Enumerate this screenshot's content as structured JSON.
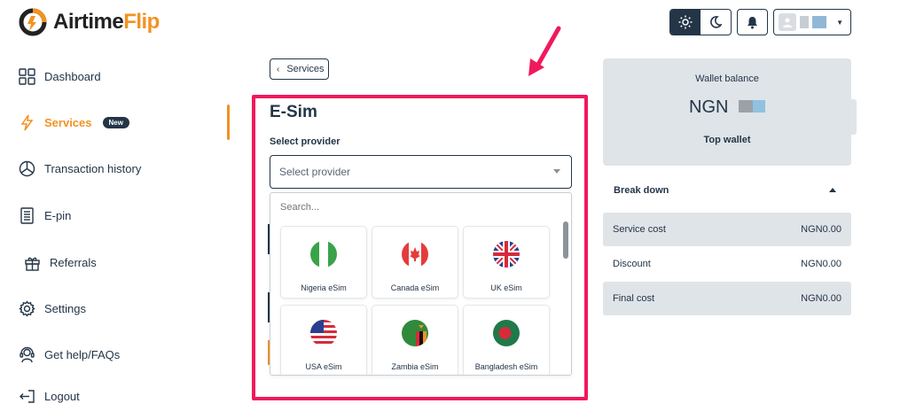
{
  "logo": {
    "text_a": "Airtime",
    "text_b": "Flip"
  },
  "sidebar": {
    "items": [
      {
        "label": "Dashboard",
        "icon": "grid-icon"
      },
      {
        "label": "Services",
        "icon": "lightning-icon",
        "badge": "New"
      },
      {
        "label": "Transaction history",
        "icon": "pie-chart-icon"
      },
      {
        "label": "E-pin",
        "icon": "receipt-icon"
      },
      {
        "label": "Referrals",
        "icon": "gift-icon"
      },
      {
        "label": "Settings",
        "icon": "gear-icon"
      },
      {
        "label": "Get help/FAQs",
        "icon": "headset-icon"
      },
      {
        "label": "Logout",
        "icon": "logout-icon"
      }
    ]
  },
  "header": {
    "theme": "light"
  },
  "back": {
    "label": "Services"
  },
  "esim": {
    "title": "E-Sim",
    "provider_label": "Select provider",
    "provider_placeholder": "Select provider",
    "search_placeholder": "Search...",
    "providers": [
      {
        "name": "Nigeria eSim",
        "flag": "nigeria-flag-icon"
      },
      {
        "name": "Canada eSim",
        "flag": "canada-flag-icon"
      },
      {
        "name": "UK eSim",
        "flag": "uk-flag-icon"
      },
      {
        "name": "USA eSim",
        "flag": "usa-flag-icon"
      },
      {
        "name": "Zambia eSim",
        "flag": "zambia-flag-icon"
      },
      {
        "name": "Bangladesh eSim",
        "flag": "bangladesh-flag-icon"
      }
    ]
  },
  "wallet": {
    "label": "Wallet balance",
    "currency": "NGN",
    "top_label": "Top wallet"
  },
  "breakdown": {
    "title": "Break down",
    "rows": [
      {
        "label": "Service cost",
        "value": "NGN0.00"
      },
      {
        "label": "Discount",
        "value": "NGN0.00"
      },
      {
        "label": "Final cost",
        "value": "NGN0.00"
      }
    ]
  },
  "colors": {
    "accent": "#f29222",
    "navy": "#233547",
    "highlight": "#f0195c",
    "panel": "#dfe4e8"
  }
}
